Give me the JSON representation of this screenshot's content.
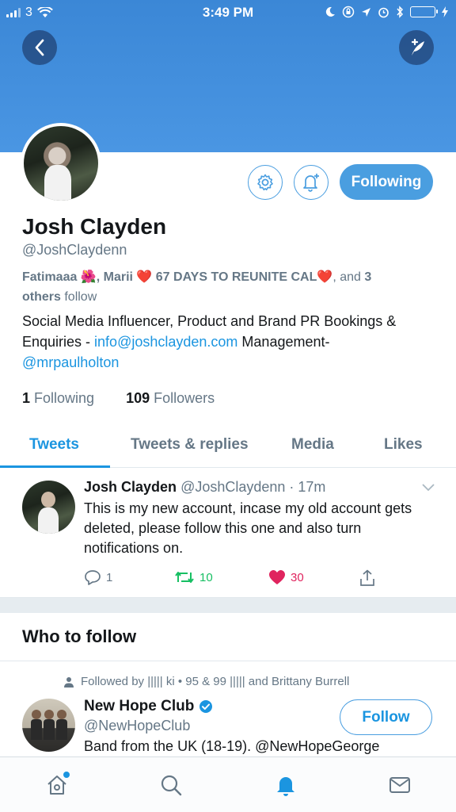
{
  "status_bar": {
    "carrier": "3",
    "time": "3:49 PM",
    "battery_color": "#4cd964"
  },
  "header": {
    "back_icon": "chevron-left-icon",
    "compose_icon": "compose-quill-icon",
    "banner_color": "#4a96e3"
  },
  "profile": {
    "name": "Josh Clayden",
    "handle": "@JoshClaydenn",
    "followed_by": {
      "names": "Fatimaaa 🌺, Marii ❤️ 67 DAYS TO REUNITE CAL❤️",
      "connector": ", and ",
      "count": "3",
      "suffix": "others",
      "tail": " follow"
    },
    "bio": {
      "part1": "Social Media Influencer, Product and Brand PR Bookings & Enquiries - ",
      "email": "info@joshclayden.com",
      "part2": " Management-",
      "mention": "@mrpaulholton"
    },
    "following_count": "1",
    "following_label": "Following",
    "followers_count": "109",
    "followers_label": "Followers",
    "following_button": "Following"
  },
  "tabs": [
    {
      "label": "Tweets",
      "active": true
    },
    {
      "label": "Tweets & replies"
    },
    {
      "label": "Media"
    },
    {
      "label": "Likes"
    }
  ],
  "tweet": {
    "name": "Josh Clayden",
    "meta": "@JoshClaydenn · 17m",
    "text": "This is my new account, incase my old account gets deleted, please follow this one and also turn notifications on.",
    "replies": "1",
    "retweets": "10",
    "likes": "30"
  },
  "who_to_follow": {
    "title": "Who to follow",
    "context": "Followed by ||||| ki • 95 & 99 ||||| and Brittany Burrell",
    "name": "New Hope Club",
    "handle": "@NewHopeClub",
    "bio": "Band from the UK (18-19). @NewHopeGeorge",
    "follow_button": "Follow"
  },
  "tabbar": {
    "items": [
      "home-icon",
      "search-icon",
      "notifications-icon",
      "messages-icon"
    ],
    "accent": "#1b95e0"
  }
}
